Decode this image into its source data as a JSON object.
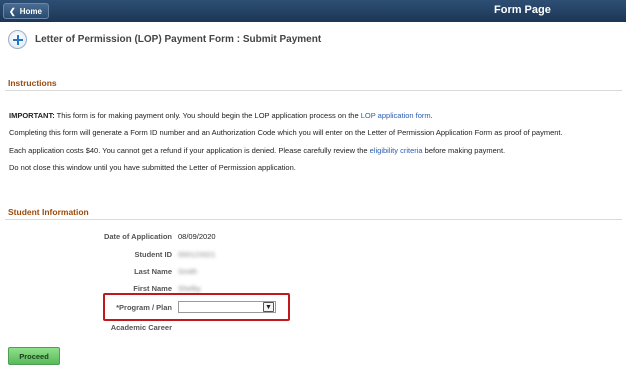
{
  "topbar": {
    "home_label": "Home",
    "page_name": "Form Page"
  },
  "header": {
    "title": "Letter of Permission (LOP) Payment Form :  Submit Payment"
  },
  "instructions": {
    "heading": "Instructions",
    "important_label": "IMPORTANT:",
    "line1_text": " This form is for making payment only. You should begin the LOP application process on the ",
    "line1_link": "LOP application form",
    "line1_end": ".",
    "line2": "Completing this form will generate a Form ID number and an Authorization Code which you will enter on the Letter of Permission Application Form as proof of payment.",
    "line3_text": "Each application costs $40. You cannot get a refund if your application is denied. Please carefully review the ",
    "line3_link": "eligibility criteria",
    "line3_end": " before making payment.",
    "line4": "Do not close this window until you have submitted the Letter of Permission application."
  },
  "student": {
    "heading": "Student Information",
    "date_label": "Date of Application",
    "date_value": "08/09/2020",
    "id_label": "Student ID",
    "id_value": "000123321",
    "last_label": "Last Name",
    "last_value": "Smith",
    "first_label": "First Name",
    "first_value": "Shelby",
    "program_label": "*Program / Plan",
    "program_value": "",
    "career_label": "Academic Career"
  },
  "actions": {
    "proceed_label": "Proceed"
  },
  "colors": {
    "topbar": "#1c3654",
    "section_heading": "#9a4b0d",
    "link": "#2a5db0",
    "highlight": "#c0181b",
    "proceed": "#59b95b"
  }
}
